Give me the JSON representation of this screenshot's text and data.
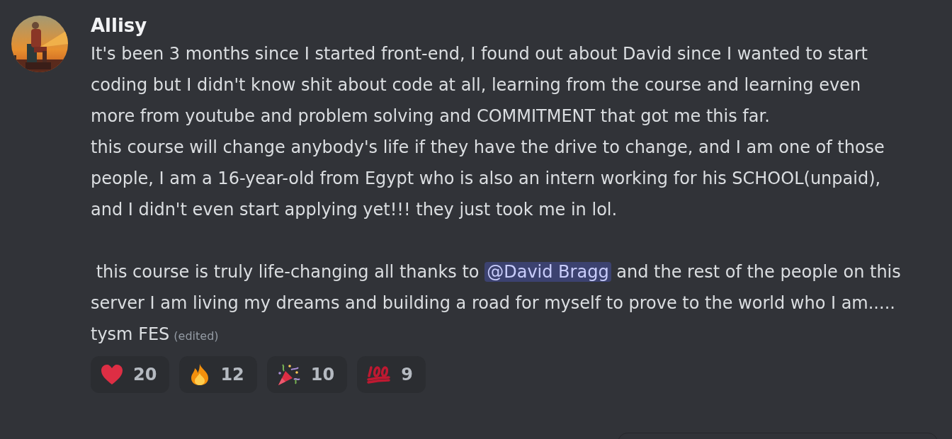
{
  "message": {
    "author": "Allisy",
    "avatar": {
      "kind": "picture"
    },
    "paragraphs": [
      [
        {
          "kind": "text",
          "text": "It's been 3 months since I started front-end, I found out about David since I wanted to start coding but I didn't know shit about code at all, learning from the course and learning even more from youtube and problem solving and COMMITMENT that got me this far."
        }
      ],
      [
        {
          "kind": "text",
          "text": "this course will change anybody's life if they have the drive to change, and I am one of those people, I am a 16-year-old from Egypt who is also an intern working for his SCHOOL(unpaid), and I didn't even start applying yet!!! they just took me in lol."
        }
      ],
      [
        {
          "kind": "text",
          "text": " this course is truly life-changing all thanks to "
        },
        {
          "kind": "mention",
          "text": "@David Bragg"
        },
        {
          "kind": "text",
          "text": " and the rest of the people on this server I am living my dreams and building a road for myself to prove to the world who I am..... tysm FES"
        }
      ]
    ],
    "edited": "(edited)"
  },
  "reactions": [
    {
      "kind": "heart",
      "count": "20"
    },
    {
      "kind": "fire",
      "count": "12"
    },
    {
      "kind": "party",
      "count": "10"
    },
    {
      "kind": "hundred",
      "count": "9"
    }
  ]
}
